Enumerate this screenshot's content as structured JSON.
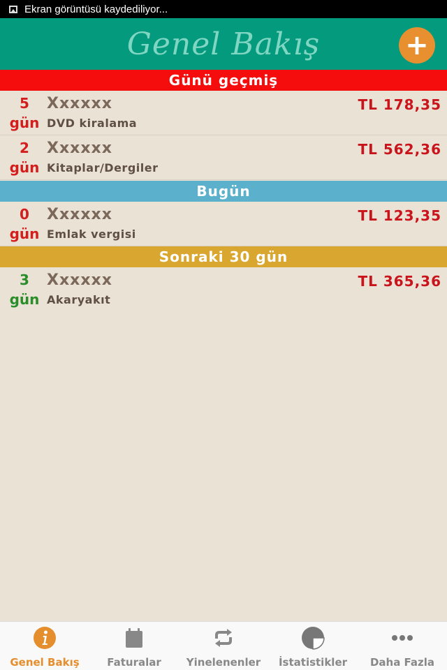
{
  "status_bar": {
    "text": "Ekran görüntüsü kaydediliyor..."
  },
  "header": {
    "title": "Genel Bakış",
    "add_label": "+"
  },
  "sections": [
    {
      "title": "Günü geçmiş",
      "color": "#f50c0c"
    },
    {
      "title": "Bugün",
      "color": "#5bb1cb"
    },
    {
      "title": "Sonraki 30 gün",
      "color": "#d9a62f"
    }
  ],
  "bills": [
    {
      "days": "5",
      "unit": "gün",
      "payee": "Xxxxxx",
      "category": "DVD kiralama",
      "amount": "TL 178,35",
      "days_color": "red"
    },
    {
      "days": "2",
      "unit": "gün",
      "payee": "Xxxxxx",
      "category": "Kitaplar/Dergiler",
      "amount": "TL 562,36",
      "days_color": "red"
    },
    {
      "days": "0",
      "unit": "gün",
      "payee": "Xxxxxx",
      "category": "Emlak vergisi",
      "amount": "TL 123,35",
      "days_color": "red"
    },
    {
      "days": "3",
      "unit": "gün",
      "payee": "Xxxxxx",
      "category": "Akaryakıt",
      "amount": "TL 365,36",
      "days_color": "green"
    }
  ],
  "nav": [
    {
      "label": "Genel Bakış",
      "icon": "info-icon",
      "active": true
    },
    {
      "label": "Faturalar",
      "icon": "calendar-icon",
      "active": false
    },
    {
      "label": "Yinelenenler",
      "icon": "repeat-icon",
      "active": false
    },
    {
      "label": "İstatistikler",
      "icon": "pie-chart-icon",
      "active": false
    },
    {
      "label": "Daha Fazla",
      "icon": "more-icon",
      "active": false
    }
  ],
  "colors": {
    "accent": "#e58e2e",
    "appbar": "#049a7e",
    "background": "#ebe2d6"
  }
}
